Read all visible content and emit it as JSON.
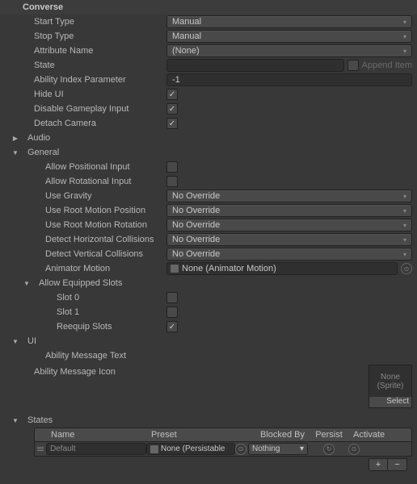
{
  "header": {
    "title": "Converse"
  },
  "converse": {
    "start_type_label": "Start Type",
    "start_type_value": "Manual",
    "stop_type_label": "Stop Type",
    "stop_type_value": "Manual",
    "attribute_name_label": "Attribute Name",
    "attribute_name_value": "(None)",
    "state_label": "State",
    "state_value": "",
    "append_item_label": "Append Item",
    "ability_index_param_label": "Ability Index Parameter",
    "ability_index_param_value": "-1",
    "hide_ui_label": "Hide UI",
    "disable_gameplay_input_label": "Disable Gameplay Input",
    "detach_camera_label": "Detach Camera"
  },
  "audio": {
    "title": "Audio"
  },
  "general": {
    "title": "General",
    "allow_pos_input_label": "Allow Positional Input",
    "allow_rot_input_label": "Allow Rotational Input",
    "use_gravity_label": "Use Gravity",
    "use_gravity_value": "No Override",
    "use_root_pos_label": "Use Root Motion Position",
    "use_root_pos_value": "No Override",
    "use_root_rot_label": "Use Root Motion Rotation",
    "use_root_rot_value": "No Override",
    "detect_h_label": "Detect Horizontal Collisions",
    "detect_h_value": "No Override",
    "detect_v_label": "Detect Vertical Collisions",
    "detect_v_value": "No Override",
    "animator_motion_label": "Animator Motion",
    "animator_motion_value": "None (Animator Motion)",
    "equipped_slots_label": "Allow Equipped Slots",
    "slot0_label": "Slot 0",
    "slot1_label": "Slot 1",
    "reequip_label": "Reequip Slots"
  },
  "ui": {
    "title": "UI",
    "message_text_label": "Ability Message Text",
    "message_icon_label": "Ability Message Icon",
    "sprite_none": "None\n(Sprite)",
    "select_label": "Select"
  },
  "states": {
    "title": "States",
    "columns": {
      "name": "Name",
      "preset": "Preset",
      "blocked": "Blocked By",
      "persist": "Persist",
      "activate": "Activate"
    },
    "rows": [
      {
        "name": "Default",
        "preset": "None (Persistable",
        "blocked": "Nothing"
      }
    ],
    "add": "+",
    "remove": "−"
  }
}
